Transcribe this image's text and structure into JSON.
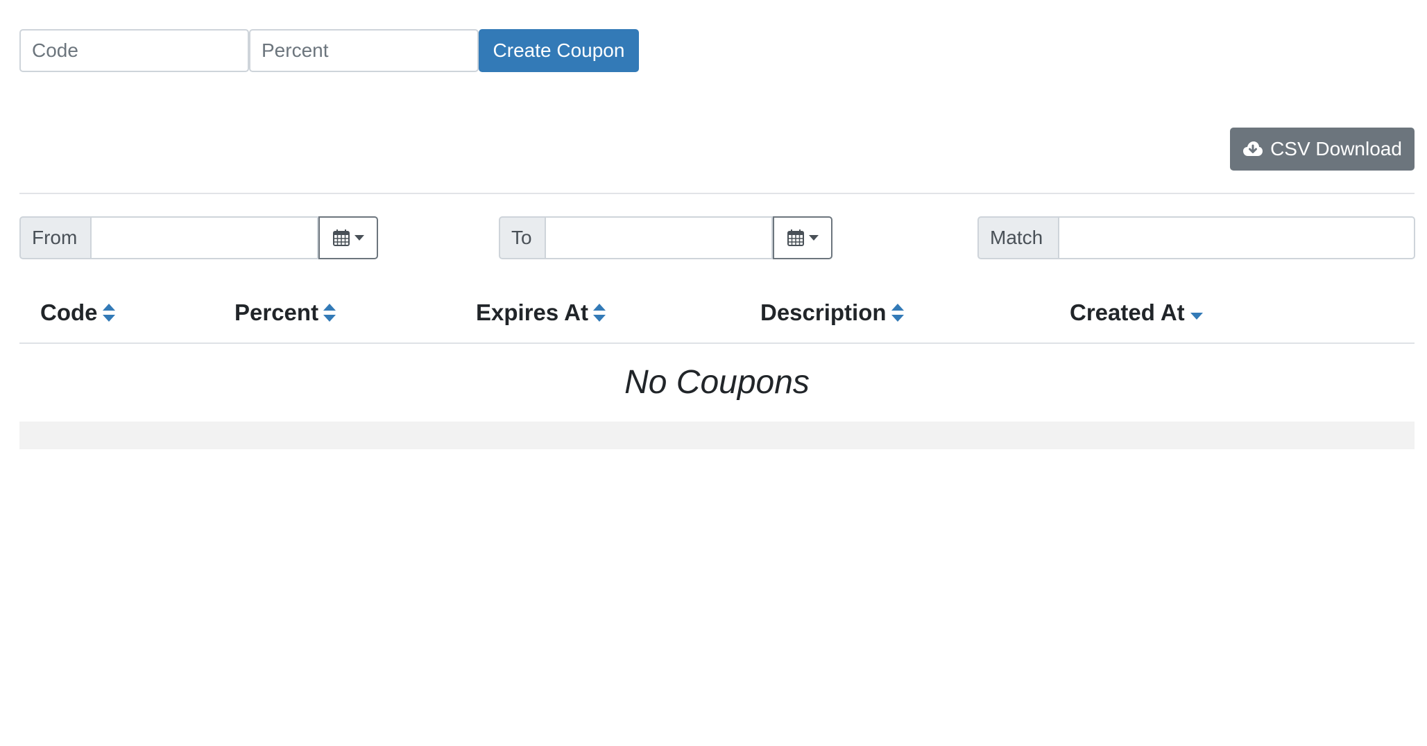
{
  "create_form": {
    "code_placeholder": "Code",
    "percent_placeholder": "Percent",
    "create_button_label": "Create Coupon"
  },
  "toolbar": {
    "csv_download_label": "CSV Download",
    "csv_icon": "cloud-download-icon"
  },
  "filters": {
    "from_label": "From",
    "to_label": "To",
    "match_label": "Match",
    "calendar_icon": "calendar-icon"
  },
  "table": {
    "columns": [
      {
        "label": "Code",
        "sort": "unsorted"
      },
      {
        "label": "Percent",
        "sort": "unsorted"
      },
      {
        "label": "Expires At",
        "sort": "unsorted"
      },
      {
        "label": "Description",
        "sort": "unsorted"
      },
      {
        "label": "Created At",
        "sort": "descending"
      }
    ],
    "empty_message": "No Coupons"
  },
  "colors": {
    "primary": "#337ab7",
    "secondary": "#6c757d",
    "sort_icon": "#337ab7"
  }
}
